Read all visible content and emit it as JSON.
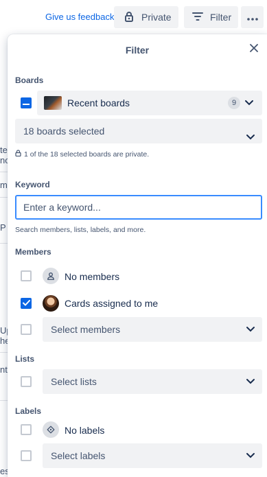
{
  "toolbar": {
    "feedback_label": "Give us feedback!",
    "private_label": "Private",
    "filter_label": "Filter",
    "more_icon": "more-icon"
  },
  "background": {
    "fragments": [
      "te",
      "no",
      "ma",
      "P",
      "Up",
      "he",
      "nt",
      "es"
    ]
  },
  "filter_panel": {
    "title": "Filter",
    "boards": {
      "section_label": "Boards",
      "recent_boards_label": "Recent boards",
      "recent_boards_count": "9",
      "selected_label": "18 boards selected",
      "private_note": "1 of the 18 selected boards are private."
    },
    "keyword": {
      "section_label": "Keyword",
      "placeholder": "Enter a keyword...",
      "value": "",
      "hint": "Search members, lists, labels, and more."
    },
    "members": {
      "section_label": "Members",
      "no_members_label": "No members",
      "assigned_label": "Cards assigned to me",
      "select_placeholder": "Select members"
    },
    "lists": {
      "section_label": "Lists",
      "select_placeholder": "Select lists"
    },
    "labels": {
      "section_label": "Labels",
      "no_labels_label": "No labels",
      "select_placeholder": "Select labels"
    }
  },
  "colors": {
    "accent": "#0c66e4",
    "focus_border": "#388bff",
    "button_bg": "#f1f2f4",
    "text": "#172b4d",
    "subtle_text": "#44546f"
  }
}
